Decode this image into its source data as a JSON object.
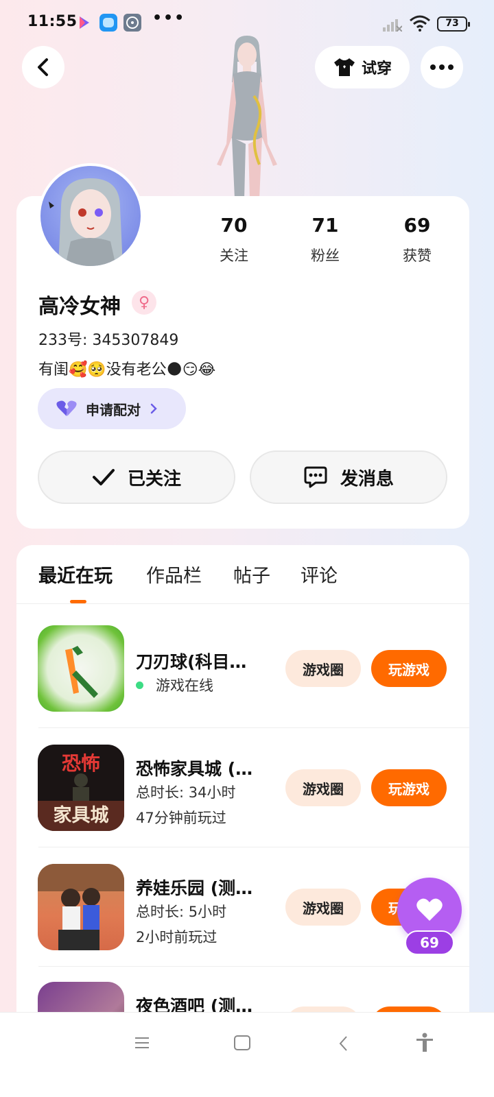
{
  "status_bar": {
    "time": "11:55",
    "dots": "•••",
    "battery": "73"
  },
  "header": {
    "tryon_label": "试穿"
  },
  "profile": {
    "stats": [
      {
        "value": "70",
        "label": "关注"
      },
      {
        "value": "71",
        "label": "粉丝"
      },
      {
        "value": "69",
        "label": "获赞"
      }
    ],
    "nickname": "高冷女神",
    "gender_symbol": "♀",
    "user_id": "233号: 345307849",
    "bio": "有闺🥰🥺没有老公🌑😏😂",
    "pair_label": "申请配对",
    "follow_label": "已关注",
    "message_label": "发消息"
  },
  "tabs": [
    {
      "label": "最近在玩"
    },
    {
      "label": "作品栏"
    },
    {
      "label": "帖子"
    },
    {
      "label": "评论"
    }
  ],
  "games": [
    {
      "title": "刀刃球(科目…",
      "status": "游戏在线",
      "circle_label": "游戏圈",
      "play_label": "玩游戏"
    },
    {
      "title": "恐怖家具城 (…",
      "line1": "总时长: 34小时",
      "line2": "47分钟前玩过",
      "icon_text_top": "恐怖",
      "icon_text_bottom": "家具城",
      "circle_label": "游戏圈",
      "play_label": "玩游戏"
    },
    {
      "title": "养娃乐园 (测…",
      "line1": "总时长: 5小时",
      "line2": "2小时前玩过",
      "circle_label": "游戏圈",
      "play_label": "玩游戏"
    },
    {
      "title": "夜色酒吧 (测…"
    }
  ],
  "like_float": {
    "count": "69"
  },
  "colors": {
    "accent_orange": "#ff6a00",
    "purple": "#b55ef2",
    "online_green": "#3ddc84"
  }
}
